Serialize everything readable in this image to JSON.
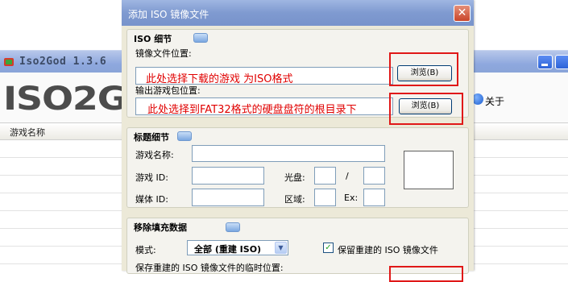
{
  "background_window": {
    "title": "Iso2God 1.3.6",
    "logo": "ISO2G",
    "about_label": "关于",
    "column_header": "游戏名称"
  },
  "dialog": {
    "title": "添加 ISO 镜像文件",
    "close_glyph": "✕",
    "iso_details": {
      "title": "ISO 细节",
      "image_location_label": "镜像文件位置:",
      "image_location_value": "此处选择下载的游戏 为ISO格式",
      "browse1_label": "浏览(B)",
      "output_location_label": "输出游戏包位置:",
      "output_location_value": "此处选择到FAT32格式的硬盘盘符的根目录下",
      "browse2_label": "浏览(B)"
    },
    "title_details": {
      "title": "标题细节",
      "game_name_label": "游戏名称:",
      "game_id_label": "游戏 ID:",
      "disc_label": "光盘:",
      "disc_separator": "/",
      "media_id_label": "媒体 ID:",
      "region_label": "区域:",
      "ex_label": "Ex:"
    },
    "remove_padding": {
      "title": "移除填充数据",
      "mode_label": "模式:",
      "mode_value": "全部 (重建 ISO)",
      "keep_rebuilt_label": "保留重建的 ISO 镜像文件",
      "keep_rebuilt_checked": true,
      "check_glyph": "✓",
      "temp_location_label": "保存重建的 ISO 镜像文件的临时位置:"
    }
  },
  "colors": {
    "annotation_red": "#e00000",
    "dialog_title_blue": "#7f9ad0",
    "dialog_body": "#ece9d8"
  }
}
